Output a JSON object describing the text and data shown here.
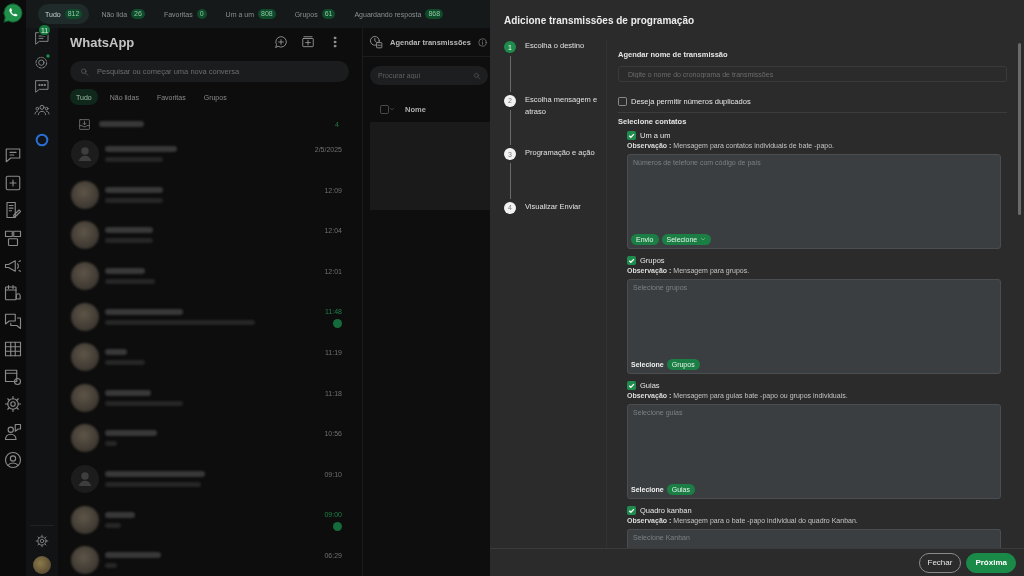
{
  "topbar": {
    "tabs": [
      {
        "label": "Tudo",
        "count": "812",
        "selected": true
      },
      {
        "label": "Não lida",
        "count": "26",
        "selected": false
      },
      {
        "label": "Favoritas",
        "count": "0",
        "selected": false
      },
      {
        "label": "Um a um",
        "count": "808",
        "selected": false
      },
      {
        "label": "Grupos",
        "count": "61",
        "selected": false
      },
      {
        "label": "Aguardando resposta",
        "count": "868",
        "selected": false
      }
    ]
  },
  "nav": {
    "chats_badge": "11"
  },
  "chat_list": {
    "title": "WhatsApp",
    "search": {
      "placeholder": "Pesquisar ou começar uma nova conversa"
    },
    "filters": [
      {
        "label": "Tudo",
        "selected": true
      },
      {
        "label": "Não lidas",
        "selected": false
      },
      {
        "label": "Favoritas",
        "selected": false
      },
      {
        "label": "Grupos",
        "selected": false
      }
    ],
    "archived": {
      "count": "4"
    },
    "chats": [
      {
        "kind": "default",
        "time": "2/5/2025",
        "unread": false
      },
      {
        "kind": "photo",
        "time": "12:09",
        "unread": false
      },
      {
        "kind": "photo",
        "time": "12:04",
        "unread": false
      },
      {
        "kind": "photo",
        "time": "12:01",
        "unread": false
      },
      {
        "kind": "photo",
        "time": "11:48",
        "unread": true
      },
      {
        "kind": "photo",
        "time": "11:19",
        "unread": false
      },
      {
        "kind": "photo",
        "time": "11:18",
        "unread": false
      },
      {
        "kind": "photo",
        "time": "10:56",
        "unread": false
      },
      {
        "kind": "default",
        "time": "09:10",
        "unread": false
      },
      {
        "kind": "photo",
        "time": "09:00",
        "unread": true
      },
      {
        "kind": "photo",
        "time": "06:29",
        "unread": false
      }
    ]
  },
  "schedule_panel": {
    "title": "Agendar transmissões",
    "search": {
      "placeholder": "Procurar aqui"
    },
    "table": {
      "select_all": {
        "checked": false
      },
      "columns": [
        "Nome"
      ]
    }
  },
  "dialog": {
    "title": "Adicione transmissões de programação",
    "steps": [
      {
        "number": "1",
        "label": "Escolha o destino",
        "selected": true
      },
      {
        "number": "2",
        "label": "Escolha mensagem e atraso",
        "selected": false
      },
      {
        "number": "3",
        "label": "Programação e ação",
        "selected": false
      },
      {
        "number": "4",
        "label": "Visualizar Enviar",
        "selected": false
      }
    ],
    "name_field": {
      "label": "Agendar nome de transmissão",
      "placeholder": "Digite o nome do cronograma de transmissões"
    },
    "allow_duplicates": {
      "label": "Deseja permitir números duplicados",
      "checked": false
    },
    "contacts_heading": "Selecione contatos",
    "sections": [
      {
        "label": "Um a um",
        "checked": true,
        "note": "**Observação :** Mensagem para contatos individuais de bate -papo.",
        "placeholder": "Números de telefone com código de país",
        "actions": [
          {
            "kind": "chip",
            "label": "Envio"
          },
          {
            "kind": "dropdown",
            "label": "Selecione"
          }
        ]
      },
      {
        "label": "Grupos",
        "checked": true,
        "note": "**Observação :** Mensagem para grupos.",
        "placeholder": "Selecione grupos",
        "actions": [
          {
            "kind": "text",
            "label": "Selecione"
          },
          {
            "kind": "chip",
            "label": "Grupos"
          }
        ]
      },
      {
        "label": "Guias",
        "checked": true,
        "note": "**Observação :** Mensagem para guias bate -papo ou grupos individuais.",
        "placeholder": "Selecione guias",
        "actions": [
          {
            "kind": "text",
            "label": "Selecione"
          },
          {
            "kind": "chip",
            "label": "Guias"
          }
        ]
      },
      {
        "label": "Quadro kanban",
        "checked": true,
        "note": "**Observação :** Mensagem para o bate -papo individual do quadro Kanban.",
        "placeholder": "Selecione Kanban"
      }
    ],
    "buttons": [
      {
        "kind": "close",
        "label": "Fechar"
      },
      {
        "kind": "next",
        "label": "Próxima"
      }
    ]
  }
}
